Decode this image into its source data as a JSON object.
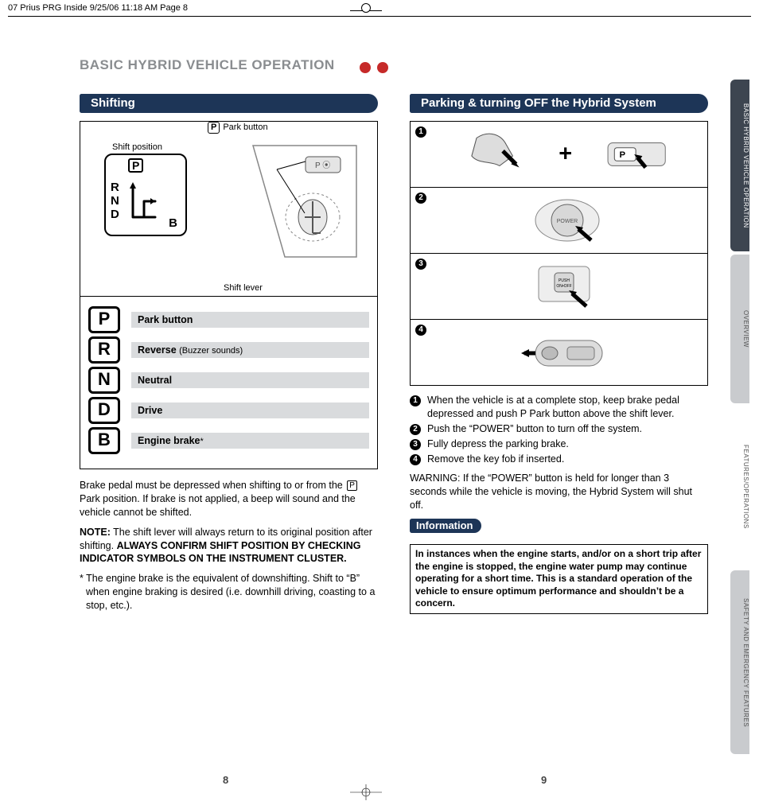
{
  "print_header": "07 Prius PRG Inside  9/25/06  11:18 AM  Page 8",
  "page_title": "BASIC HYBRID VEHICLE OPERATION",
  "shifting": {
    "heading": "Shifting",
    "labels": {
      "shift_position": "Shift position",
      "park_button": "Park button",
      "shift_lever": "Shift lever",
      "p_letter": "P",
      "gate_letters": "R\nN\nD",
      "b_letter": "B"
    },
    "legend": [
      {
        "letter": "P",
        "label": "Park button",
        "sub": ""
      },
      {
        "letter": "R",
        "label": "Reverse ",
        "sub": "(Buzzer sounds)"
      },
      {
        "letter": "N",
        "label": "Neutral",
        "sub": ""
      },
      {
        "letter": "D",
        "label": "Drive",
        "sub": ""
      },
      {
        "letter": "B",
        "label": "Engine brake",
        "sub": "*"
      }
    ],
    "para1_a": "Brake pedal must be depressed when shifting to or from the ",
    "para1_b": " Park position. If brake is not applied, a beep will sound and the vehicle cannot be shifted.",
    "note_label": "NOTE:",
    "note_text_a": " The shift lever will always return to its original position after shifting. ",
    "note_text_b": "ALWAYS CONFIRM SHIFT POSITION BY CHECKING INDICATOR SYMBOLS ON THE INSTRUMENT CLUSTER.",
    "footnote": "* The engine brake is the equivalent of downshifting. Shift to “B” when engine braking is desired (i.e. downhill driving, coasting to a stop, etc.)."
  },
  "parking": {
    "heading": "Parking & turning OFF the Hybrid System",
    "steps": [
      "1",
      "2",
      "3",
      "4"
    ],
    "list": [
      {
        "n": "1",
        "t_a": "When the vehicle is at a complete stop, keep brake pedal depressed and push ",
        "t_b": " Park button above the shift lever."
      },
      {
        "n": "2",
        "t": "Push the “POWER” button to turn off the system."
      },
      {
        "n": "3",
        "t": "Fully depress the parking brake."
      },
      {
        "n": "4",
        "t": "Remove the key fob if inserted."
      }
    ],
    "warning": "WARNING: If the “POWER” button is held for longer than 3 seconds while the vehicle is moving, the Hybrid System will shut off.",
    "info_heading": "Information",
    "info_text": "In instances when the engine starts, and/or on a short trip after the engine is stopped, the engine water pump may continue operating for a short time. This is a standard operation of the vehicle to ensure optimum performance and shouldn’t be a concern."
  },
  "side_tabs": [
    "BASIC HYBRID VEHICLE OPERATION",
    "OVERVIEW",
    "FEATURES/OPERATIONS",
    "SAFETY AND EMERGENCY FEATURES"
  ],
  "page_numbers": {
    "left": "8",
    "right": "9"
  }
}
